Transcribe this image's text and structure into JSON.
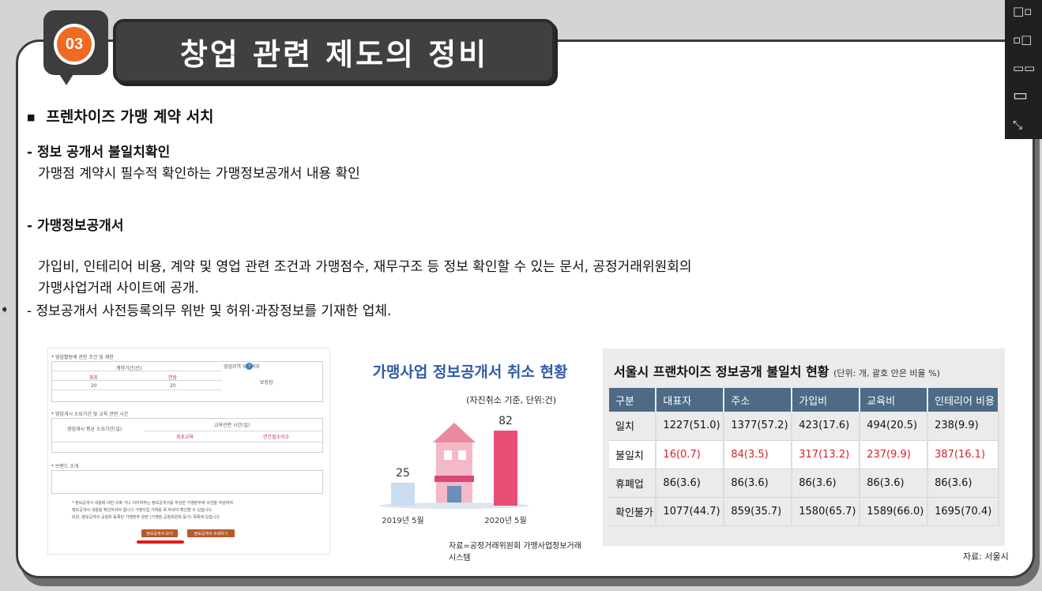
{
  "slide": {
    "badge": "03",
    "title": "창업 관련 제도의 정비"
  },
  "window_controls": [
    "□▫",
    "▫□",
    "▭▭",
    "▭",
    "⤡"
  ],
  "content": {
    "bullet_heading": "프렌차이즈 가맹 계약 서치",
    "section1": {
      "heading": "- 정보 공개서 불일치확인",
      "body": "가맹점 계약시 필수적  확인하는 가맹정보공개서 내용 확인"
    },
    "section2": {
      "heading": "- 가맹정보공개서",
      "body_line1": "가입비, 인테리어 비용, 계약 및 영업 관련 조건과 가맹점수, 재무구조 등 정보 확인할 수 있는 문서, 공정거래위원회의",
      "body_line2": "가맹사업거래 사이트에 공개.",
      "body_line3": "- 정보공개서 사전등록의무 위반 및 허위·과장정보를 기재한 업체."
    }
  },
  "form_image": {
    "section1_title": "* 영업활동에 관한 조건 및 제한",
    "col_period": "계약기간(년)",
    "col_renew": "영업지역 보호여부",
    "sub_first": "최초",
    "sub_extend": "연장",
    "val_first": "20",
    "val_extend": "20",
    "val_renew": "보장함",
    "section2_title": "* 영업개시 소요기간 및 교육 관련 시간",
    "col_avg": "영업개시 평균 소요기간(일)",
    "col_edu": "교육관련 시간(일)",
    "sub_edu1": "최초교육",
    "sub_edu2": "연간필수이수",
    "section3_title": "* 브랜드 소개",
    "notice1": "* 정보공개서 내용에 대한 의혹 거나 의지여부는 정보공개서를 작성한 가맹본부에 의견을 작성하여",
    "notice2": "정보공개서 내용을 확인하셔야 합니다 가맹사업 거래를 꼭 하셔야 확인할 수 있습니다.",
    "notice3": "또한, 정보공개서 공정위 등록된 가맹본부 관련 (가맹점 공정위원회 등기) 목록에 있습니다",
    "button1": "정보공개서 보기",
    "button2": "정보공개서 조회하기"
  },
  "chart_data": {
    "type": "bar",
    "title": "가맹사업 정보공개서 취소 현황",
    "subtitle": "(자진취소 기준, 단위:건)",
    "categories": [
      "2019년 5월",
      "2020년 5월"
    ],
    "values": [
      25,
      82
    ],
    "colors": [
      "#c9dcf0",
      "#e94e74"
    ],
    "source": "자료=공정거래위원회 가맹사업정보거래시스템"
  },
  "table_image": {
    "title": "서울시 프랜차이즈 정보공개 불일치 현황",
    "unit": "(단위: 개, 괄호 안은 비율 %)",
    "headers": [
      "구분",
      "대표자",
      "주소",
      "가입비",
      "교육비",
      "인테리어 비용"
    ],
    "rows": [
      [
        "일치",
        "1227(51.0)",
        "1377(57.2)",
        "423(17.6)",
        "494(20.5)",
        "238(9.9)"
      ],
      [
        "불일치",
        "16(0.7)",
        "84(3.5)",
        "317(13.2)",
        "237(9.9)",
        "387(16.1)"
      ],
      [
        "휴폐업",
        "86(3.6)",
        "86(3.6)",
        "86(3.6)",
        "86(3.6)",
        "86(3.6)"
      ],
      [
        "확인불가",
        "1077(44.7)",
        "859(35.7)",
        "1580(65.7)",
        "1589(66.0)",
        "1695(70.4)"
      ]
    ],
    "highlight_row": 1,
    "source": "자료: 서울시"
  }
}
